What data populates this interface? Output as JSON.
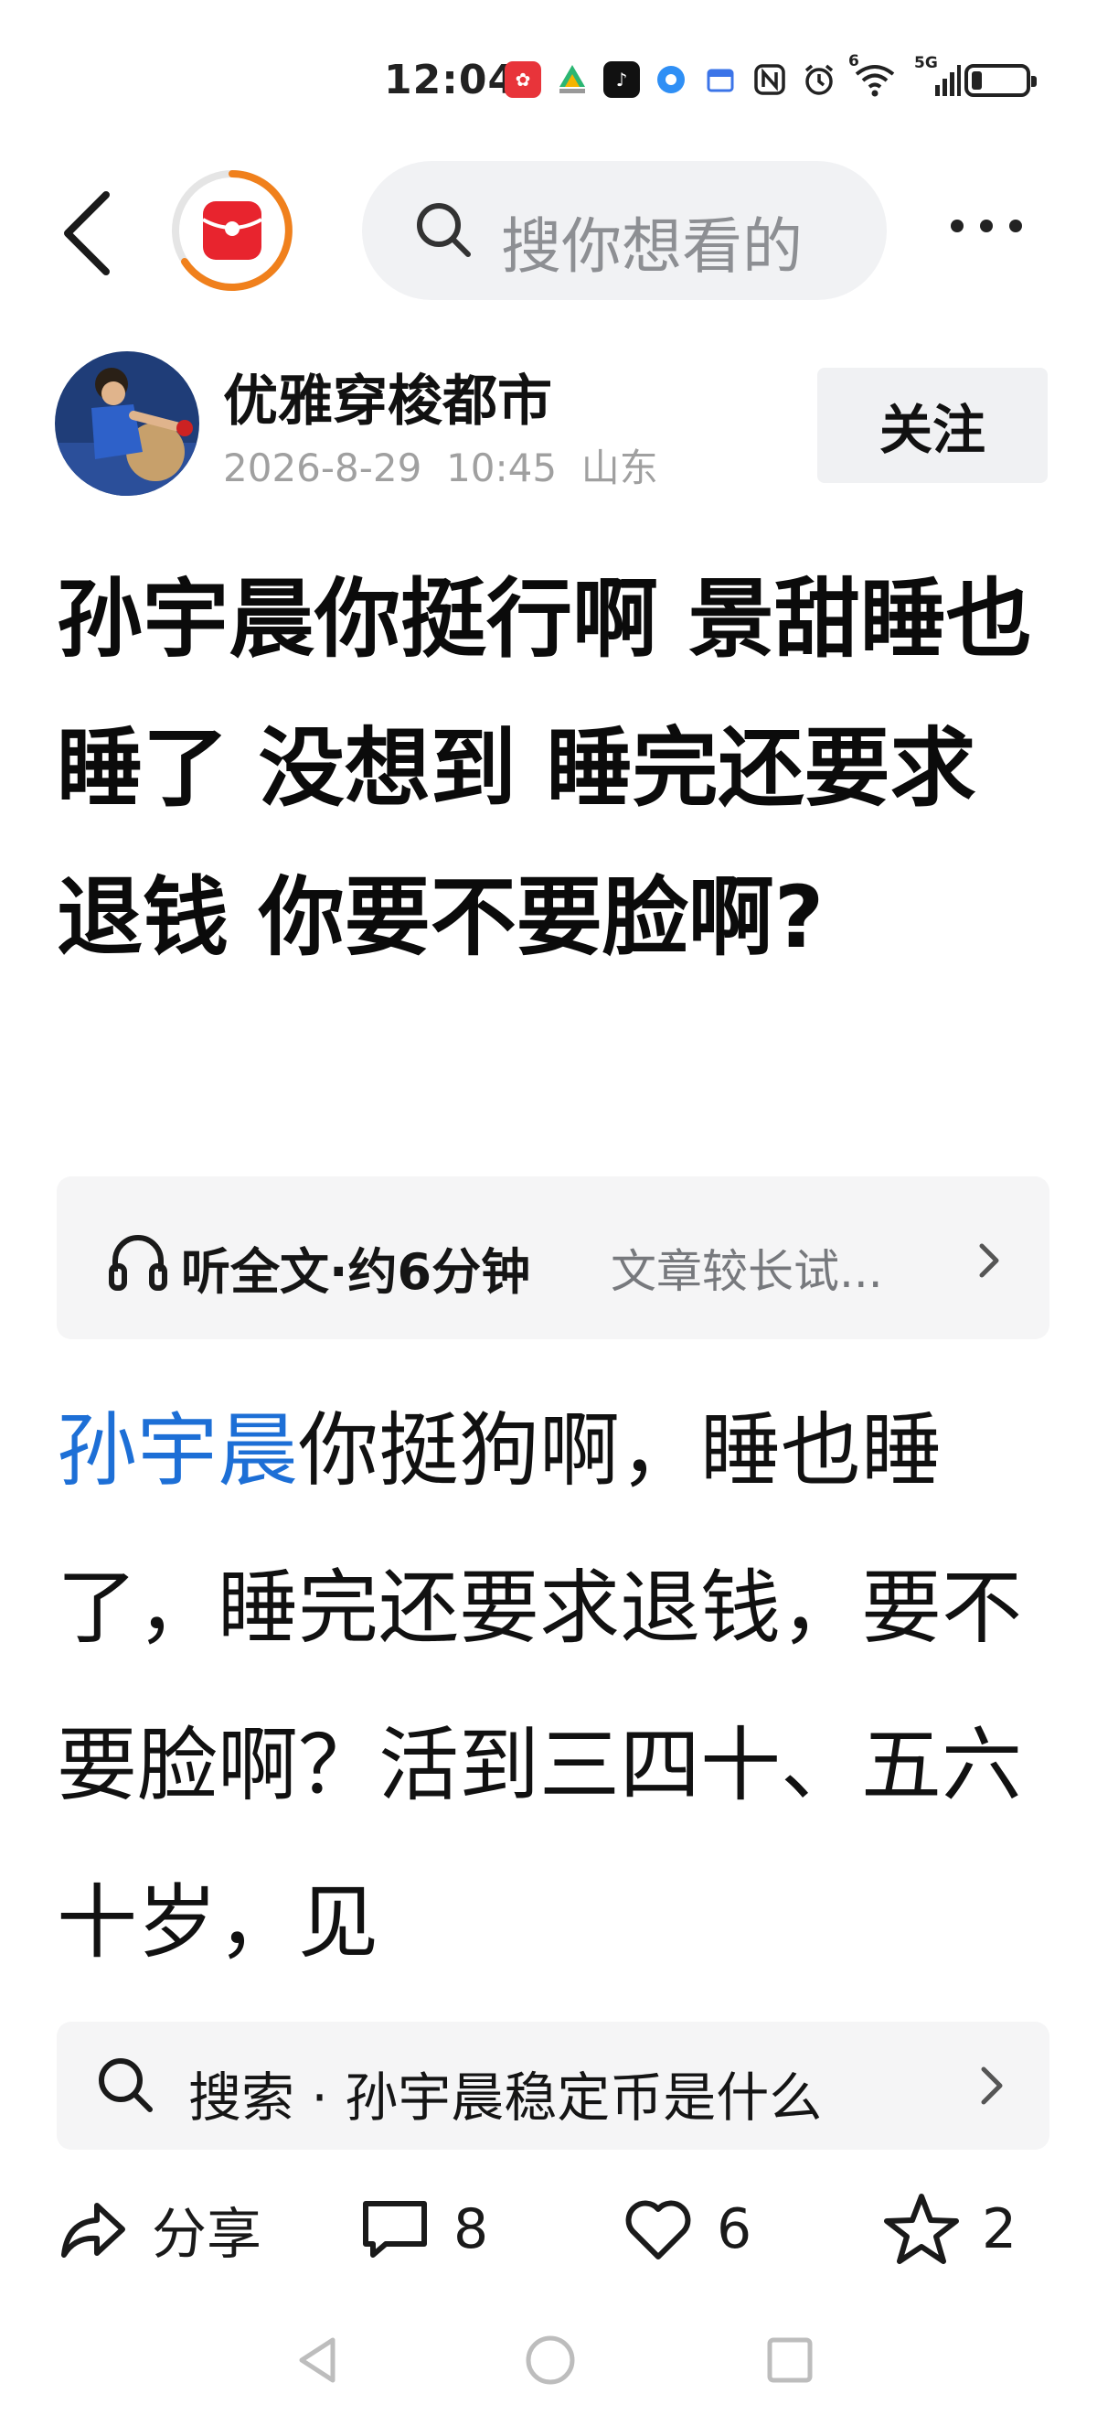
{
  "status_bar": {
    "time": "12:04",
    "icons": [
      "huawei-app-icon",
      "flower-app-icon",
      "tiktok-icon",
      "browser-icon",
      "calendar-icon",
      "nfc-icon",
      "alarm-icon",
      "wifi-icon",
      "signal-5g-icon"
    ],
    "wifi_badge": "6",
    "signal_badge": "5G",
    "battery_level": 0.2
  },
  "top_nav": {
    "search_placeholder": "搜你想看的"
  },
  "author": {
    "name": "优雅穿梭都市",
    "meta": "2026-8-29  10:45  山东",
    "follow_label": "关注"
  },
  "article": {
    "title": "孙宇晨你挺行啊 景甜睡也睡了 没想到 睡完还要求退钱 你要不要脸啊?",
    "body_link": "孙宇晨",
    "body_text": "你挺狗啊，睡也睡了，睡完还要求退钱，要不要脸啊？活到三四十、五六十岁，见"
  },
  "listen": {
    "label": "听全文·约6分钟",
    "hint": "文章较长试..."
  },
  "search_suggestion": {
    "text": "搜索 · 孙宇晨稳定币是什么"
  },
  "actions": {
    "share_label": "分享",
    "comment_count": "8",
    "like_count": "6",
    "favorite_count": "2"
  },
  "colors": {
    "accent_orange": "#f0801c",
    "accent_red": "#e8242e",
    "link_blue": "#1d6fd6"
  }
}
